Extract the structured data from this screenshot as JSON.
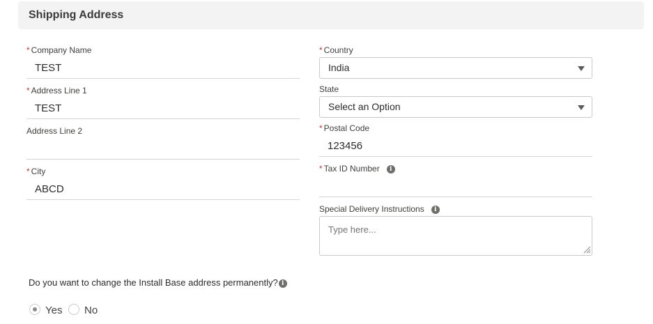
{
  "section": {
    "title": "Shipping Address"
  },
  "required_marker": "*",
  "left": {
    "company_name": {
      "label": "Company Name",
      "value": "TEST"
    },
    "address_line_1": {
      "label": "Address Line 1",
      "value": "TEST"
    },
    "address_line_2": {
      "label": "Address Line 2",
      "value": ""
    },
    "city": {
      "label": "City",
      "value": "ABCD"
    }
  },
  "right": {
    "country": {
      "label": "Country",
      "selected": "India"
    },
    "state": {
      "label": "State",
      "selected": "Select an Option"
    },
    "postal_code": {
      "label": "Postal Code",
      "value": "123456"
    },
    "tax_id": {
      "label": "Tax ID Number",
      "value": ""
    },
    "special_instructions": {
      "label": "Special Delivery Instructions",
      "placeholder": "Type here..."
    }
  },
  "info_glyph": "i",
  "question": {
    "text": "Do you want to change the Install Base address permanently?"
  },
  "radio": {
    "yes_label": "Yes",
    "no_label": "No",
    "selected": "Yes"
  },
  "colors": {
    "required": "#c23934",
    "header_bg": "#f3f3f3",
    "border": "#c9c9c9"
  }
}
